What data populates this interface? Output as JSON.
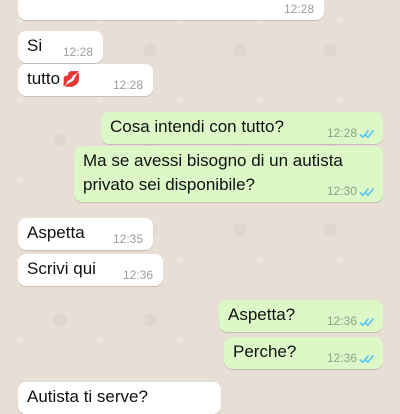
{
  "chat": {
    "messages": [
      {
        "dir": "in",
        "text": "",
        "time": "12:28"
      },
      {
        "dir": "in",
        "text": "Si",
        "time": "12:28"
      },
      {
        "dir": "in",
        "text": "tutto",
        "emoji": "💋",
        "time": "12:28"
      },
      {
        "dir": "out",
        "text": "Cosa intendi con tutto?",
        "time": "12:28",
        "status": "read"
      },
      {
        "dir": "out",
        "line1": "Ma se avessi bisogno di un autista",
        "line2": "privato sei disponibile?",
        "time": "12:30",
        "status": "read"
      },
      {
        "dir": "in",
        "text": "Aspetta",
        "time": "12:35"
      },
      {
        "dir": "in",
        "text": "Scrivi qui",
        "time": "12:36"
      },
      {
        "dir": "out",
        "text": "Aspetta?",
        "time": "12:36",
        "status": "read"
      },
      {
        "dir": "out",
        "text": "Perche?",
        "time": "12:36",
        "status": "read"
      },
      {
        "dir": "in",
        "text": "Autista ti serve?",
        "time": ""
      }
    ]
  },
  "colors": {
    "incoming_bubble": "#ffffff",
    "outgoing_bubble": "#dcf8c6",
    "read_receipt": "#4fc3f7",
    "background": "#e7ded5"
  }
}
